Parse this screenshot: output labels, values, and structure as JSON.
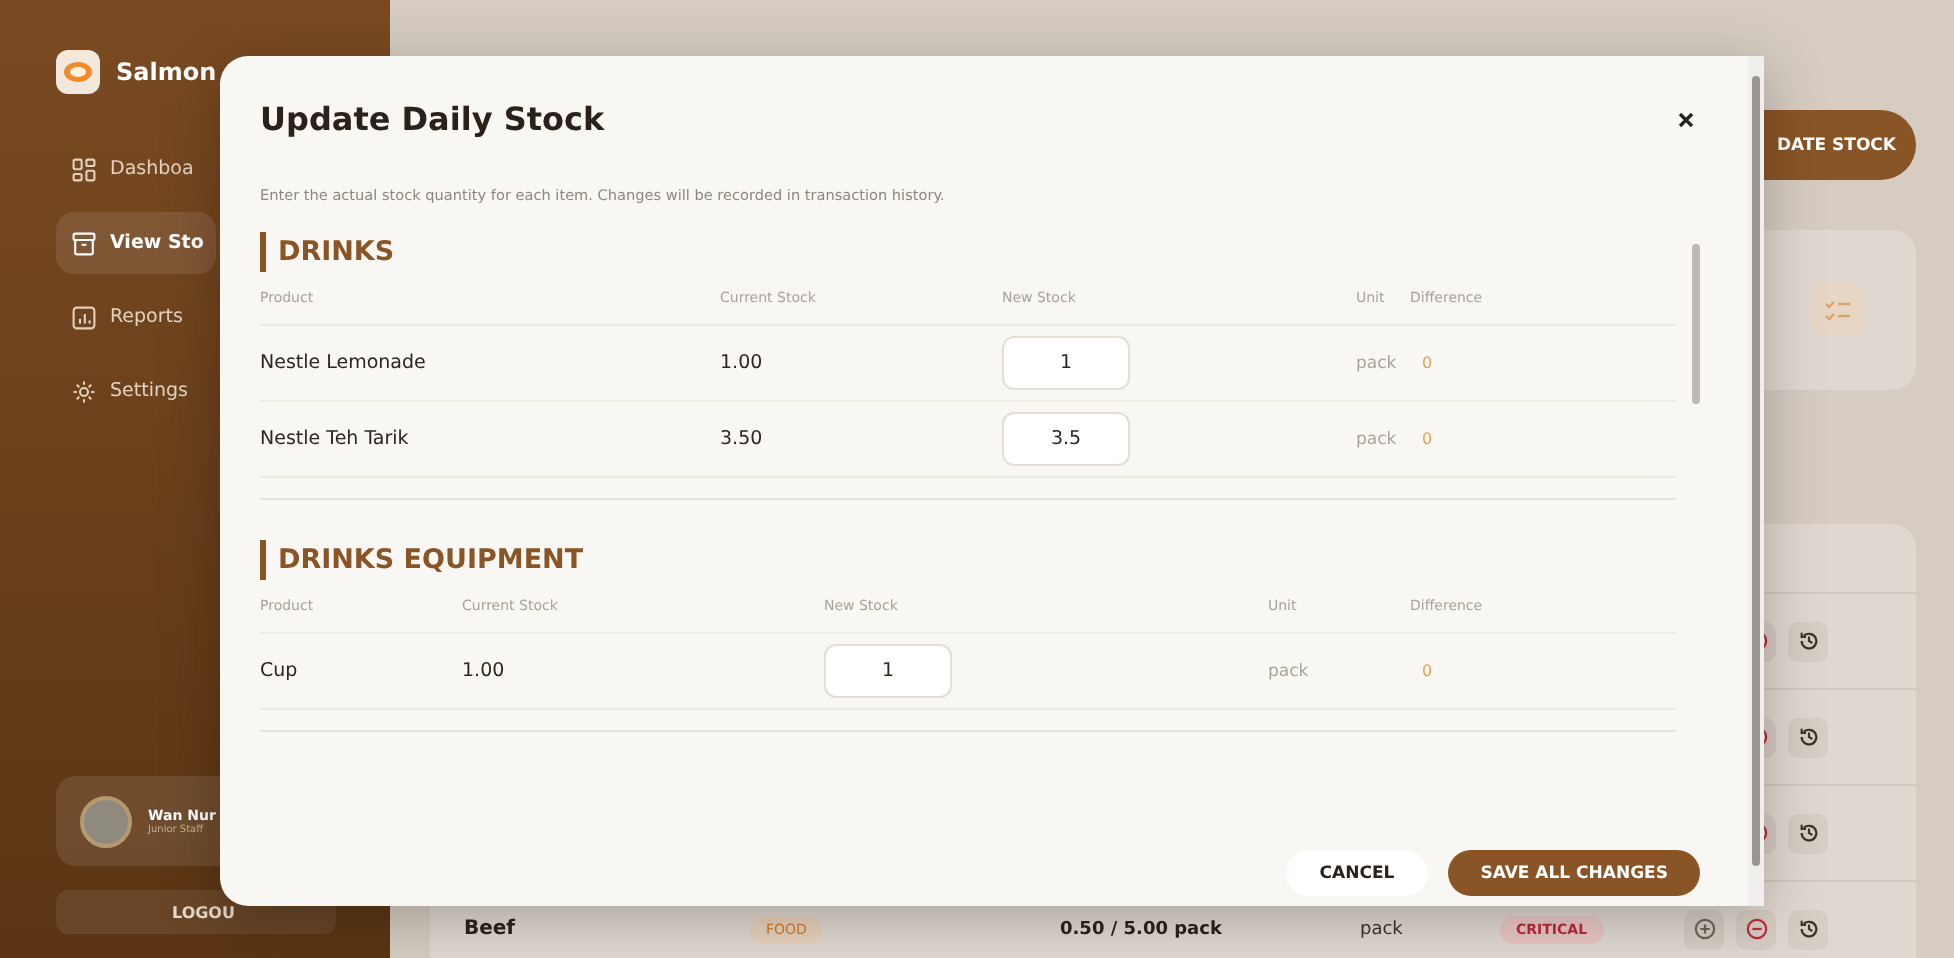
{
  "sidebar": {
    "brand": "Salmon",
    "nav": [
      {
        "label": "Dashboa",
        "selected": false
      },
      {
        "label": "View Sto",
        "selected": true
      },
      {
        "label": "Reports",
        "selected": false
      },
      {
        "label": "Settings",
        "selected": false
      }
    ],
    "user": {
      "name": "Wan Nur",
      "role": "Junior Staff"
    },
    "logout": "LOGOU"
  },
  "header": {
    "update_button": "DATE STOCK"
  },
  "table": {
    "rows": [
      {},
      {},
      {},
      {
        "name": "Beef",
        "category": "FOOD",
        "stock": "0.50 / 5.00 pack",
        "unit": "pack",
        "status": "CRITICAL"
      }
    ]
  },
  "modal": {
    "title": "Update Daily Stock",
    "description": "Enter the actual stock quantity for each item. Changes will be recorded in transaction history.",
    "sections": [
      {
        "name": "DRINKS",
        "columns": [
          "Product",
          "Current Stock",
          "New Stock",
          "Unit",
          "Difference"
        ],
        "rows": [
          {
            "product": "Nestle Lemonade",
            "current": "1.00",
            "new": "1",
            "unit": "pack",
            "difference": "0"
          },
          {
            "product": "Nestle Teh Tarik",
            "current": "3.50",
            "new": "3.5",
            "unit": "pack",
            "difference": "0"
          }
        ]
      },
      {
        "name": "DRINKS EQUIPMENT",
        "columns": [
          "Product",
          "Current Stock",
          "New Stock",
          "Unit",
          "Difference"
        ],
        "rows": [
          {
            "product": "Cup",
            "current": "1.00",
            "new": "1",
            "unit": "pack",
            "difference": "0"
          }
        ]
      }
    ],
    "cancel": "CANCEL",
    "save": "SAVE ALL CHANGES"
  }
}
